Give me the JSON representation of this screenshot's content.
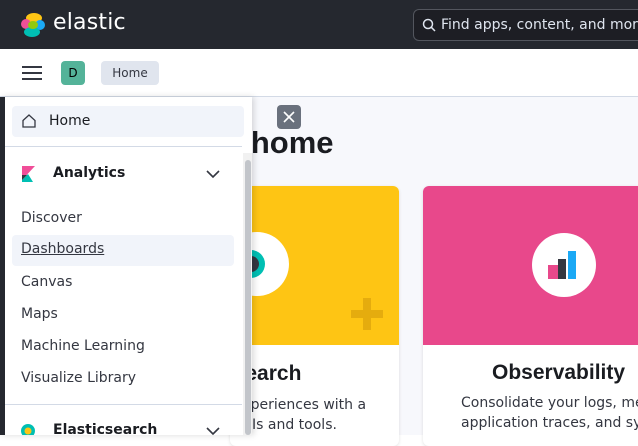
{
  "header": {
    "brand": "elastic",
    "search_placeholder": "Find apps, content, and more."
  },
  "subheader": {
    "avatar_letter": "D",
    "breadcrumb": "Home"
  },
  "main": {
    "title": "e home",
    "cards": [
      {
        "title": "csearch",
        "desc_lines": [
          "experiences with a",
          "APIs and tools."
        ]
      },
      {
        "title": "Observability",
        "desc_lines": [
          "Consolidate your logs, met",
          "application traces, and sys"
        ]
      }
    ]
  },
  "nav": {
    "home_label": "Home",
    "groups": [
      {
        "label": "Analytics",
        "items": [
          "Discover",
          "Dashboards",
          "Canvas",
          "Maps",
          "Machine Learning",
          "Visualize Library"
        ]
      },
      {
        "label": "Elasticsearch",
        "items": []
      }
    ]
  },
  "colors": {
    "topbar": "#25282f",
    "elasticsearch_banner": "#fec514",
    "observability_banner": "#e8488b",
    "avatar": "#54b399"
  }
}
